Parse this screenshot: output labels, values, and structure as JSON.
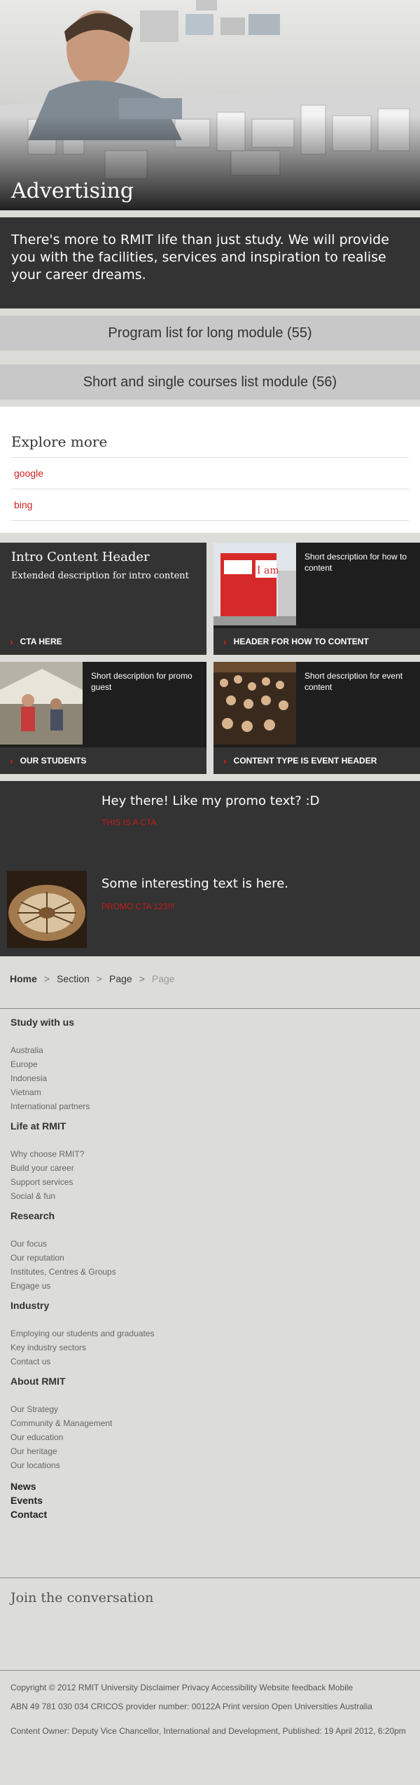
{
  "hero": {
    "title": "Advertising"
  },
  "intro": {
    "text": "There's more to RMIT life than just study. We will provide you with the facilities, services and inspiration to realise your career dreams."
  },
  "modules": {
    "long": "Program list for long module (55)",
    "short": "Short and single courses list module (56)"
  },
  "explore": {
    "heading": "Explore more",
    "links": [
      "google",
      "bing"
    ]
  },
  "tiles": {
    "intro": {
      "header": "Intro Content Header",
      "description": "Extended description for intro content",
      "cta": "CTA HERE"
    },
    "howto": {
      "description": "Short description for how to content",
      "cta": "HEADER FOR HOW TO CONTENT"
    },
    "promo_guest": {
      "description": "Short description for promo guest",
      "cta": "OUR STUDENTS"
    },
    "event": {
      "description": "Short description for event content",
      "cta": "CONTENT TYPE IS EVENT HEADER"
    }
  },
  "promo": {
    "first": {
      "heading": "Hey there! Like my promo text? :D",
      "cta": "THIS IS A CTA"
    },
    "second": {
      "heading": "Some interesting text is here.",
      "cta": "PROMO CTA 123!!!"
    }
  },
  "breadcrumb": {
    "home": "Home",
    "section": "Section",
    "page": "Page",
    "current": "Page",
    "separator": ">"
  },
  "footer_nav": {
    "study": {
      "heading": "Study with us",
      "items": [
        "Australia",
        "Europe",
        "Indonesia",
        "Vietnam",
        "International partners"
      ]
    },
    "life": {
      "heading": "Life at RMIT",
      "items": [
        "Why choose RMIT?",
        "Build your career",
        "Support services",
        "Social & fun"
      ]
    },
    "research": {
      "heading": "Research",
      "items": [
        "Our focus",
        "Our reputation",
        "Institutes, Centres & Groups",
        "Engage us"
      ]
    },
    "industry": {
      "heading": "Industry",
      "items": [
        "Employing our students and graduates",
        "Key industry sectors",
        "Contact us"
      ]
    },
    "about": {
      "heading": "About RMIT",
      "items": [
        "Our Strategy",
        "Community & Management",
        "Our education",
        "Our heritage",
        "Our locations"
      ]
    },
    "bold_links": [
      "News",
      "Events",
      "Contact"
    ]
  },
  "join": {
    "heading": "Join the conversation"
  },
  "legal": {
    "line1": "Copyright © 2012 RMIT University Disclaimer Privacy Accessibility Website feedback Mobile",
    "line2": "ABN 49 781 030 034 CRICOS provider number: 00122A Print version Open Universities Australia",
    "line3": "Content Owner: Deputy Vice Chancellor, International and Development, Published: 19 April 2012, 6:20pm"
  },
  "colors": {
    "accent_red": "#d11f1f",
    "dark_panel": "#333333",
    "tile_dark": "#1e1e1e",
    "page_bg": "#dcdcd8"
  }
}
